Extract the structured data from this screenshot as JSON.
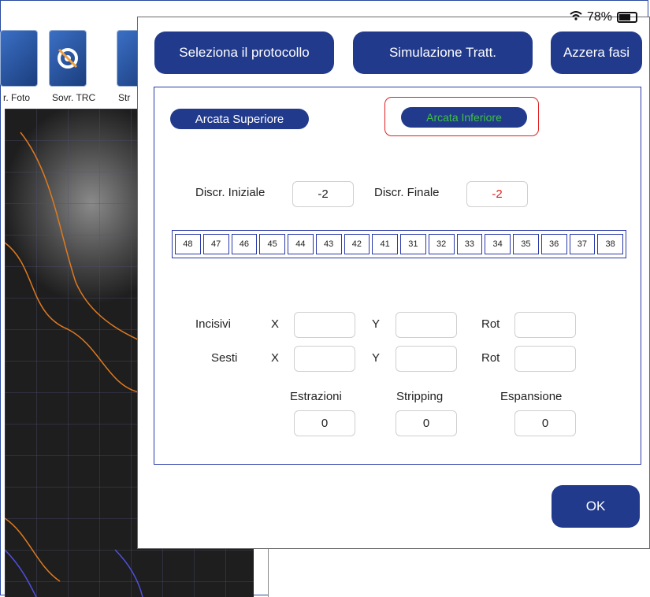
{
  "status": {
    "battery": "78%"
  },
  "background": {
    "tools": [
      {
        "label": "r. Foto"
      },
      {
        "label": "Sovr. TRC"
      },
      {
        "label": "Str"
      }
    ]
  },
  "modal": {
    "buttons": {
      "protocol": "Seleziona il protocollo",
      "simulation": "Simulazione Tratt.",
      "reset": "Azzera fasi",
      "ok": "OK"
    },
    "arches": {
      "upper": "Arcata Superiore",
      "lower": "Arcata Inferiore"
    },
    "discrepancy": {
      "initial_label": "Discr. Iniziale",
      "initial_value": "-2",
      "final_label": "Discr. Finale",
      "final_value": "-2"
    },
    "teeth": [
      "48",
      "47",
      "46",
      "45",
      "44",
      "43",
      "42",
      "41",
      "31",
      "32",
      "33",
      "34",
      "35",
      "36",
      "37",
      "38"
    ],
    "movements": {
      "incisivi_label": "Incisivi",
      "sesti_label": "Sesti",
      "x_label": "X",
      "y_label": "Y",
      "rot_label": "Rot"
    },
    "extras": {
      "estrazioni_label": "Estrazioni",
      "estrazioni_value": "0",
      "stripping_label": "Stripping",
      "stripping_value": "0",
      "espansione_label": "Espansione",
      "espansione_value": "0"
    }
  },
  "colors": {
    "button_bg": "#213a8c",
    "selected_text": "#3ec23e",
    "highlight_border": "#e02020",
    "panel_border": "#2a3aa8"
  }
}
